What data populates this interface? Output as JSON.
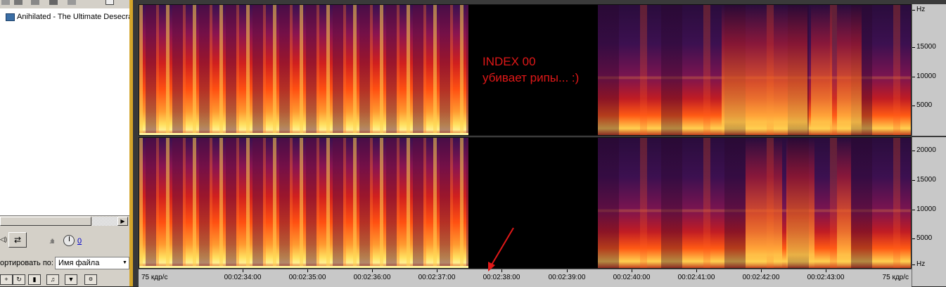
{
  "file_panel": {
    "file_name": "Anihilated - The Ultimate Desecra",
    "volume_value": "0",
    "sort_label": "ортировать по:",
    "sort_value": "Имя файла",
    "loop_label": "⇄",
    "speaker_label": "◁)"
  },
  "spectrogram": {
    "annotation": [
      "INDEX 00",
      "убивает рипы... :)"
    ],
    "scale_top": [
      "Hz",
      "15000",
      "10000",
      "5000"
    ],
    "scale_bottom": [
      "20000",
      "15000",
      "10000",
      "5000",
      "Hz"
    ],
    "fps_left": "75 кдр/с",
    "fps_right": "75 кдр/с",
    "time_labels": [
      "00:02:34:00",
      "00:02:35:00",
      "00:02:36:00",
      "00:02:37:00",
      "00:02:38:00",
      "00:02:39:00",
      "00:02:40:00",
      "00:02:41:00",
      "00:02:42:00",
      "00:02:43:00"
    ],
    "colors": {
      "silence": "#000000",
      "annotation": "#e01818",
      "hot": "#ffe060",
      "warm": "#ff4a10",
      "cool": "#3a1050"
    }
  }
}
